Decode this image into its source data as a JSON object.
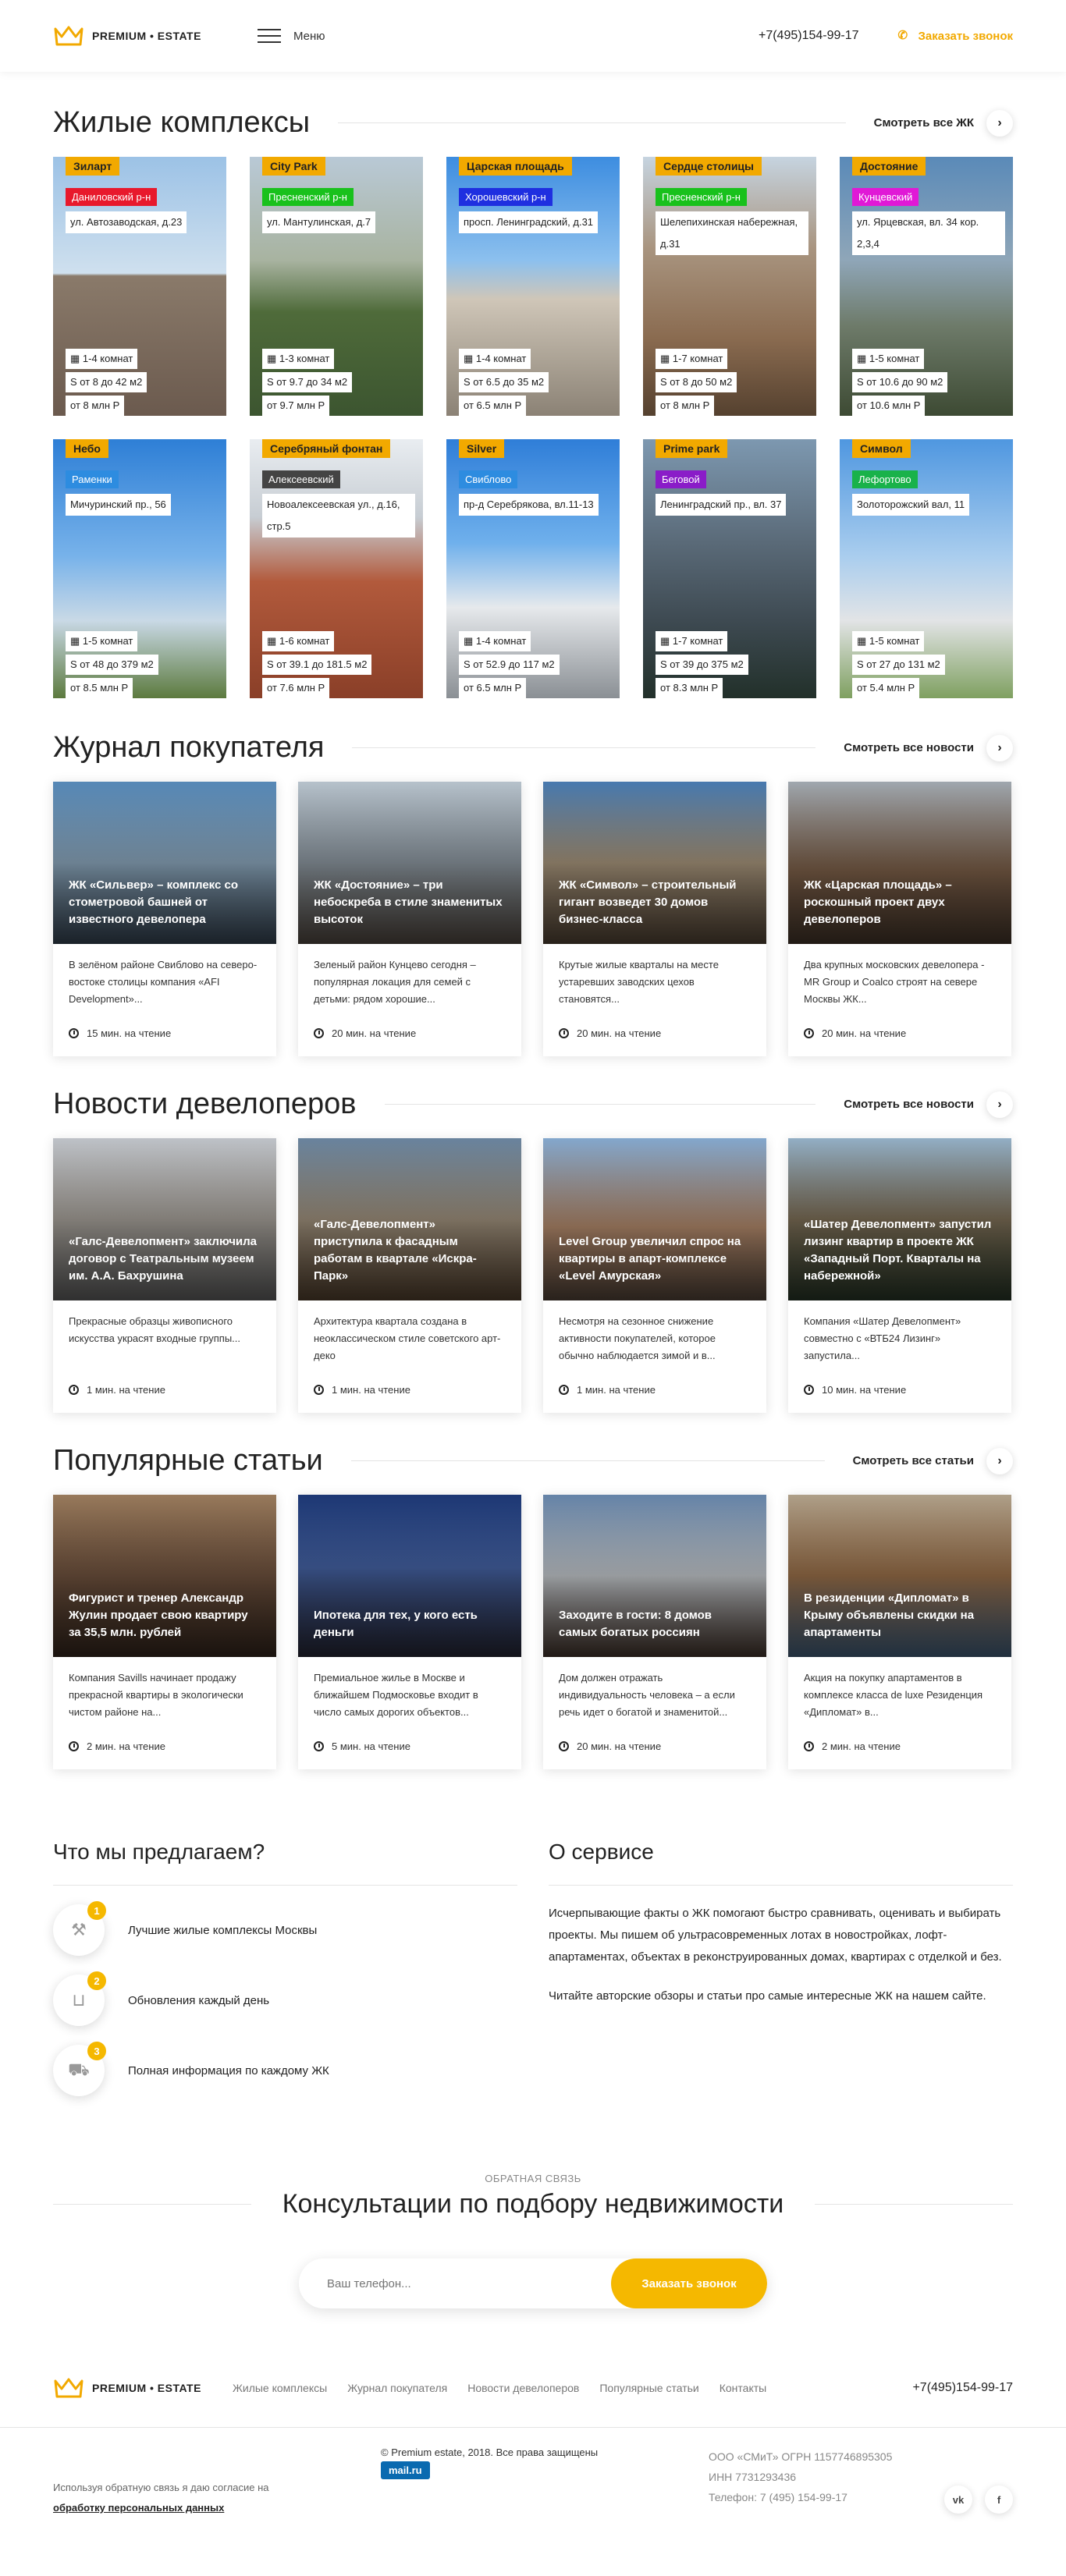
{
  "header": {
    "logo_text": "PREMIUM • ESTATE",
    "menu_label": "Меню",
    "phone": "+7(495)154-99-17",
    "callback_label": "Заказать звонок"
  },
  "complexes": {
    "title": "Жилые комплексы",
    "see_all": "Смотреть все ЖК",
    "items": [
      {
        "name": "Зиларт",
        "district": "Даниловский р-н",
        "district_color": "#e8192c",
        "address": "ул. Автозаводская, д.23",
        "rooms": "1-4 комнат",
        "area": "S от 8 до 42 м2",
        "price": "от 8 млн Р"
      },
      {
        "name": "City Park",
        "district": "Пресненский р-н",
        "district_color": "#19c11c",
        "address": "ул. Мантулинская, д.7",
        "rooms": "1-3 комнат",
        "area": "S от 9.7 до 34 м2",
        "price": "от 9.7 млн Р"
      },
      {
        "name": "Царская площадь",
        "district": "Хорошевский р-н",
        "district_color": "#1f2fe0",
        "address": "просп. Ленинградский, д.31",
        "rooms": "1-4 комнат",
        "area": "S от 6.5 до 35 м2",
        "price": "от 6.5 млн Р"
      },
      {
        "name": "Сердце столицы",
        "district": "Пресненский р-н",
        "district_color": "#19c11c",
        "address": "Шелепихинская набережная, д.31",
        "rooms": "1-7 комнат",
        "area": "S от 8 до 50 м2",
        "price": "от 8 млн Р"
      },
      {
        "name": "Достояние",
        "district": "Кунцевский",
        "district_color": "#e019d6",
        "address": "ул. Ярцевская, вл. 34 кор. 2,3,4",
        "rooms": "1-5 комнат",
        "area": "S от 10.6 до 90 м2",
        "price": "от 10.6 млн Р"
      },
      {
        "name": "Небо",
        "district": "Раменки",
        "district_color": "#2d8ce0",
        "address": "Мичуринский пр., 56",
        "rooms": "1-5 комнат",
        "area": "S от 48 до 379 м2",
        "price": "от 8.5 млн Р"
      },
      {
        "name": "Серебряный фонтан",
        "district": "Алексеевский",
        "district_color": "#444444",
        "address": "Новоалексеевская ул., д.16, стр.5",
        "rooms": "1-6 комнат",
        "area": "S от 39.1 до 181.5 м2",
        "price": "от 7.6 млн Р"
      },
      {
        "name": "Silver",
        "district": "Свиблово",
        "district_color": "#2d8ce0",
        "address": "пр-д Серебрякова, вл.11-13",
        "rooms": "1-4 комнат",
        "area": "S от 52.9 до 117 м2",
        "price": "от 6.5 млн Р"
      },
      {
        "name": "Prime park",
        "district": "Беговой",
        "district_color": "#8a1cc8",
        "address": "Ленинградский пр., вл. 37",
        "rooms": "1-7 комнат",
        "area": "S от 39 до 375 м2",
        "price": "от 8.3 млн Р"
      },
      {
        "name": "Символ",
        "district": "Лефортово",
        "district_color": "#19b24a",
        "address": "Золоторожский вал, 11",
        "rooms": "1-5 комнат",
        "area": "S от 27 до 131 м2",
        "price": "от 5.4 млн Р"
      }
    ]
  },
  "journal": {
    "title": "Журнал покупателя",
    "see_all": "Смотреть все новости",
    "items": [
      {
        "title": "ЖК «Сильвер» – комплекс со стометровой башней от известного девелопера",
        "excerpt": "В зелёном районе Свиблово на северо-востоке столицы компания «AFI Development»...",
        "time": "15 мин. на чтение"
      },
      {
        "title": "ЖК «Достояние» – три небоскреба в стиле знаменитых высоток",
        "excerpt": "Зеленый район Кунцево сегодня – популярная локация для семей с детьми: рядом хорошие...",
        "time": "20 мин. на чтение"
      },
      {
        "title": "ЖК «Символ» – строительный гигант возведет 30 домов бизнес-класса",
        "excerpt": "Крутые жилые кварталы на месте устаревших заводских цехов становятся...",
        "time": "20 мин. на чтение"
      },
      {
        "title": "ЖК «Царская площадь» – роскошный проект двух девелоперов",
        "excerpt": "Два крупных московских девелопера - MR Group и Coalco строят на севере Москвы ЖК...",
        "time": "20 мин. на чтение"
      }
    ]
  },
  "developers": {
    "title": "Новости девелоперов",
    "see_all": "Смотреть все новости",
    "items": [
      {
        "title": "«Галс-Девелопмент» заключила договор с Театральным музеем им. А.А. Бахрушина",
        "excerpt": "Прекрасные образцы живописного искусства украсят входные группы...",
        "time": "1 мин. на чтение"
      },
      {
        "title": "«Галс-Девелопмент» приступила к фасадным работам в квартале «Искра-Парк»",
        "excerpt": "Архитектура квартала создана в неоклассическом стиле советского арт-деко",
        "time": "1 мин. на чтение"
      },
      {
        "title": "Level Group увеличил спрос на квартиры в апарт-комплексе «Level Амурская»",
        "excerpt": "Несмотря на сезонное снижение активности покупателей, которое обычно наблюдается зимой и в...",
        "time": "1 мин. на чтение"
      },
      {
        "title": "«Шатер Девелопмент» запустил лизинг квартир в проекте ЖК «Западный Порт. Кварталы на набережной»",
        "excerpt": "Компания «Шатер Девелопмент» совместно с «ВТБ24 Лизинг» запустила...",
        "time": "10 мин. на чтение"
      }
    ]
  },
  "popular": {
    "title": "Популярные статьи",
    "see_all": "Смотреть все статьи",
    "items": [
      {
        "title": "Фигурист и тренер Александр Жулин продает свою квартиру за 35,5 млн. рублей",
        "excerpt": "Компания Savills начинает продажу прекрасной квартиры в экологически чистом районе на...",
        "time": "2 мин. на чтение"
      },
      {
        "title": "Ипотека для тех, у кого есть деньги",
        "excerpt": "Премиальное жилье в Москве и ближайшем Подмосковье входит в число самых дорогих объектов...",
        "time": "5 мин. на чтение"
      },
      {
        "title": "Заходите в гости: 8 домов самых богатых россиян",
        "excerpt": "Дом должен отражать индивидуальность человека – а если речь идет о богатой и знаменитой...",
        "time": "20 мин. на чтение"
      },
      {
        "title": "В резиденции «Дипломат» в Крыму объявлены скидки на апартаменты",
        "excerpt": "Акция на покупку апартаментов в комплексе класса de luxe Резиденция «Дипломат» в...",
        "time": "2 мин. на чтение"
      }
    ]
  },
  "offer": {
    "title": "Что мы предлагаем?",
    "items": [
      {
        "num": "1",
        "label": "Лучшие жилые комплексы Москвы",
        "icon": "hammer-icon"
      },
      {
        "num": "2",
        "label": "Обновления каждый день",
        "icon": "basket-icon"
      },
      {
        "num": "3",
        "label": "Полная информация по каждому ЖК",
        "icon": "car-icon"
      }
    ]
  },
  "about": {
    "title": "О сервисе",
    "p1": "Исчерпывающие факты о ЖК помогают быстро сравнивать, оценивать и выбирать проекты. Мы пишем об ультрасовременных лотах в новостройках, лофт-апартаментах, объектах в реконструированных домах, квартирах с отделкой и без.",
    "p2": "Читайте авторские обзоры и статьи про самые интересные ЖК на нашем сайте."
  },
  "consult": {
    "kicker": "Обратная связь",
    "title": "Консультации по подбору недвижимости",
    "placeholder": "Ваш телефон...",
    "button": "Заказать звонок"
  },
  "footer": {
    "logo_text": "PREMIUM • ESTATE",
    "nav": [
      "Жилые комплексы",
      "Журнал покупателя",
      "Новости девелоперов",
      "Популярные статьи",
      "Контакты"
    ],
    "phone": "+7(495)154-99-17",
    "consent_text": "Используя обратную связь я даю согласие на",
    "consent_link": "обработку персональных данных",
    "copyright": "© Premium estate, 2018. Все права защищены",
    "mail_badge": "mail.ru",
    "company": "ООО «СМиТ» ОГРН 1157746895305",
    "inn": "ИНН 7731293436",
    "company_phone": "Телефон: 7 (495) 154-99-17",
    "socials": [
      "vk",
      "f"
    ]
  }
}
